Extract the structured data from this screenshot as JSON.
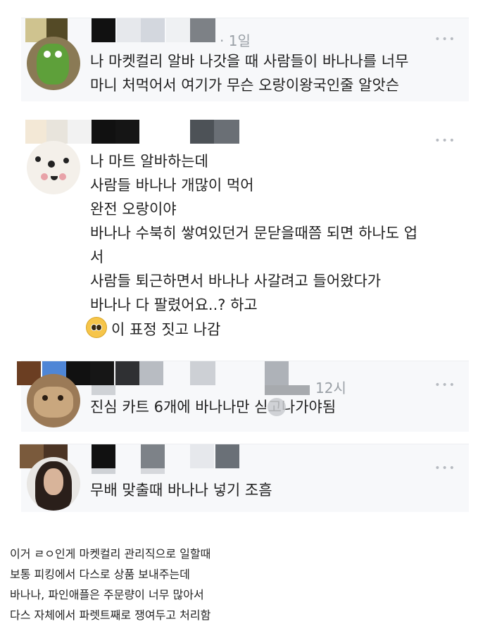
{
  "comments": [
    {
      "time": "· 1일",
      "more": "•••",
      "lines": [
        "나 마켓컬리 알바 나갓을 때 사람들이 바나나를 너무",
        "마니 처먹어서 여기가 무슨 오랑이왕국인줄 알앗슨"
      ]
    },
    {
      "more": "•••",
      "lines": [
        "나 마트 알바하는데",
        "사람들 바나나 개많이 먹어",
        "완전 오랑이야",
        "바나나 수북히 쌓여있던거 문닫을때쯤 되면 하나도 업",
        "서",
        "사람들 퇴근하면서 바나나 사갈려고 들어왔다가",
        "바나나 다 팔렸어요..? 하고",
        "이 표정 짓고 나감"
      ]
    },
    {
      "time": "12시",
      "more": "•••",
      "lines": [
        "진심 카트 6개에 바나나만 싣고나가야됨"
      ]
    },
    {
      "more": "•••",
      "lines": [
        "무배 맞출때 바나나 넣기 조흠"
      ]
    }
  ],
  "caption": [
    "이거 ㄹㅇ인게 마켓컬리 관리직으로 일할때",
    "보통 피킹에서 다스로 상품 보내주는데",
    "바나나, 파인애플은 주문량이 너무 많아서",
    "다스 자체에서 파렛트째로 쟁여두고 처리함"
  ],
  "emoji_name": "pleading-face-emoji"
}
